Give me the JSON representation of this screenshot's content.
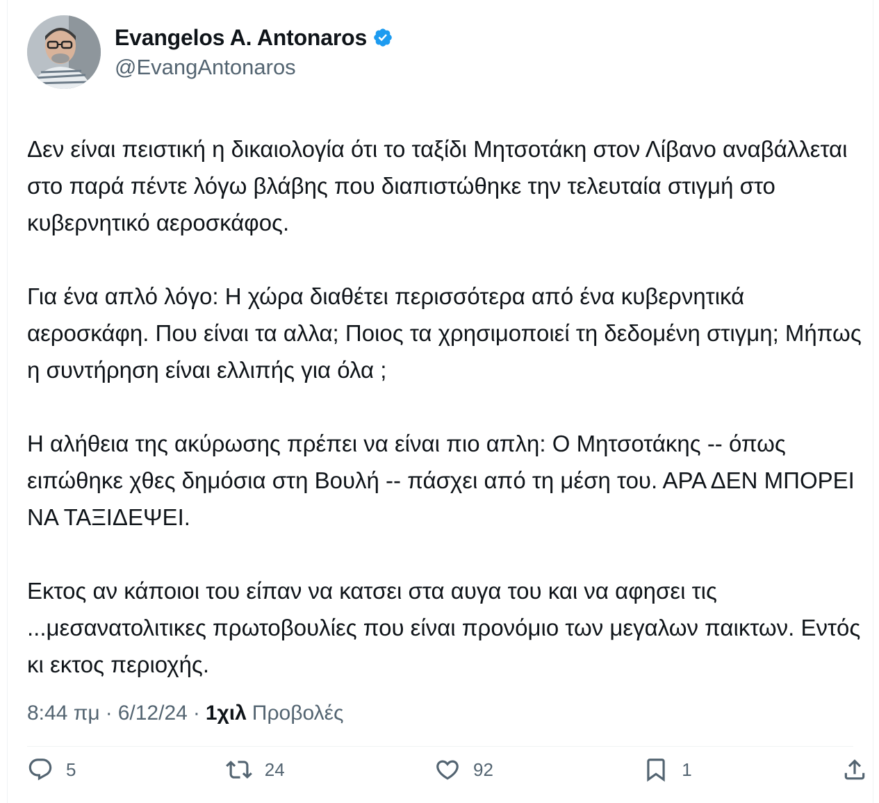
{
  "author": {
    "display_name": "Evangelos A. Antonaros",
    "handle": "@EvangAntonaros",
    "verified_color": "#1d9bf0",
    "avatar_icon": "profile-photo-icon"
  },
  "tweet": {
    "paragraphs": [
      "Δεν είναι πειστική η δικαιολογία ότι το ταξίδι Μητσοτάκη στον Λίβανο αναβάλλεται στο παρά πέντε λόγω βλάβης που διαπιστώθηκε την τελευταία στιγμή στο κυβερνητικό αεροσκάφος.",
      "Για ένα απλό λόγο: Η χώρα διαθέτει περισσότερα από ένα κυβερνητικά αεροσκάφη. Που είναι τα αλλα; Ποιος τα χρησιμοποιεί τη δεδομένη στιγμη; Μήπως η συντήρηση είναι ελλιπής για όλα ;",
      "Η αλήθεια της ακύρωσης πρέπει να είναι πιο απλη: Ο Μητσοτάκης -- όπως ειπώθηκε χθες δημόσια στη Βουλή -- πάσχει από τη μέση του. ΑΡΑ ΔΕΝ ΜΠΟΡΕΙ ΝΑ ΤΑΞΙΔΕΨΕΙ.",
      "Εκτος αν κάποιοι του είπαν να κατσει στα αυγα του και να αφησει τις ...μεσανατολιτικες πρωτοβουλίες που είναι προνόμιο των μεγαλων παικτων. Εντός κι εκτος περιοχής."
    ],
    "time": "8:44 πμ",
    "separator": "·",
    "date": "6/12/24",
    "views_count": "1χιλ",
    "views_label": "Προβολές"
  },
  "actions": {
    "replies": "5",
    "retweets": "24",
    "likes": "92",
    "bookmarks": "1"
  }
}
